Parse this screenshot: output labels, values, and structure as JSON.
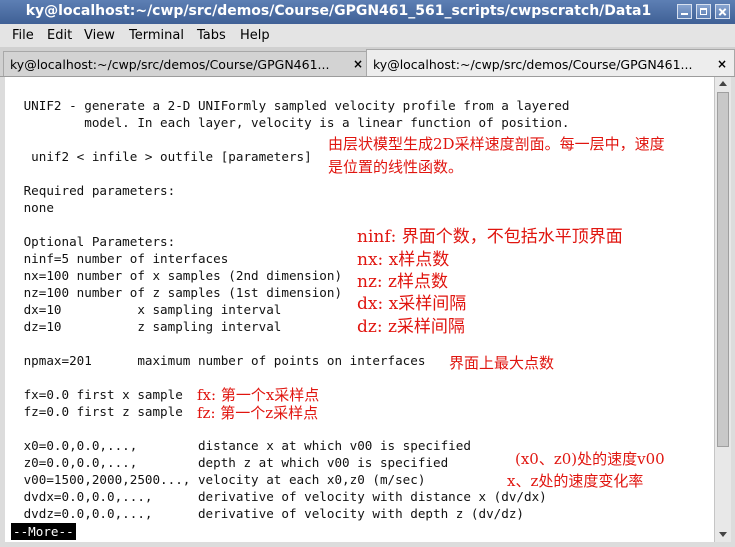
{
  "window": {
    "title": "ky@localhost:~/cwp/src/demos/Course/GPGN461_561_scripts/cwpscratch/Data1"
  },
  "menu": {
    "items": [
      "File",
      "Edit",
      "View",
      "Terminal",
      "Tabs",
      "Help"
    ]
  },
  "tabs": [
    {
      "label": "ky@localhost:~/cwp/src/demos/Course/GPGN461...",
      "active": false,
      "close": "×"
    },
    {
      "label": "ky@localhost:~/cwp/src/demos/Course/GPGN461...",
      "active": true,
      "close": "×"
    }
  ],
  "terminal": {
    "lines": [
      " UNIF2 - generate a 2-D UNIFormly sampled velocity profile from a layered",
      "         model. In each layer, velocity is a linear function of position.",
      "",
      "  unif2 < infile > outfile [parameters]",
      "",
      " Required parameters:",
      " none",
      "",
      " Optional Parameters:",
      " ninf=5 number of interfaces",
      " nx=100 number of x samples (2nd dimension)",
      " nz=100 number of z samples (1st dimension)",
      " dx=10          x sampling interval",
      " dz=10          z sampling interval",
      "",
      " npmax=201      maximum number of points on interfaces",
      "",
      " fx=0.0 first x sample",
      " fz=0.0 first z sample",
      "",
      " x0=0.0,0.0,...,        distance x at which v00 is specified",
      " z0=0.0,0.0,...,        depth z at which v00 is specified",
      " v00=1500,2000,2500..., velocity at each x0,z0 (m/sec)",
      " dvdx=0.0,0.0,...,      derivative of velocity with distance x (dv/dx)",
      " dvdz=0.0,0.0,...,      derivative of velocity with depth z (dv/dz)"
    ],
    "more_prompt": "--More--"
  },
  "annotations": {
    "unif2_a": "由层状模型生成2D采样速度剖面。每一层中，速度",
    "unif2_b": "是位置的线性函数。",
    "ninf": "ninf: 界面个数，不包括水平顶界面",
    "nx": "nx: x样点数",
    "nz": "nz: z样点数",
    "dx": "dx: x采样间隔",
    "dz": "dz: z采样间隔",
    "npmax": "界面上最大点数",
    "fx": "fx: 第一个x采样点",
    "fz": "fz: 第一个z采样点",
    "v00_a": "(x0、z0)处的速度v00",
    "v00_b": "x、z处的速度变化率"
  }
}
